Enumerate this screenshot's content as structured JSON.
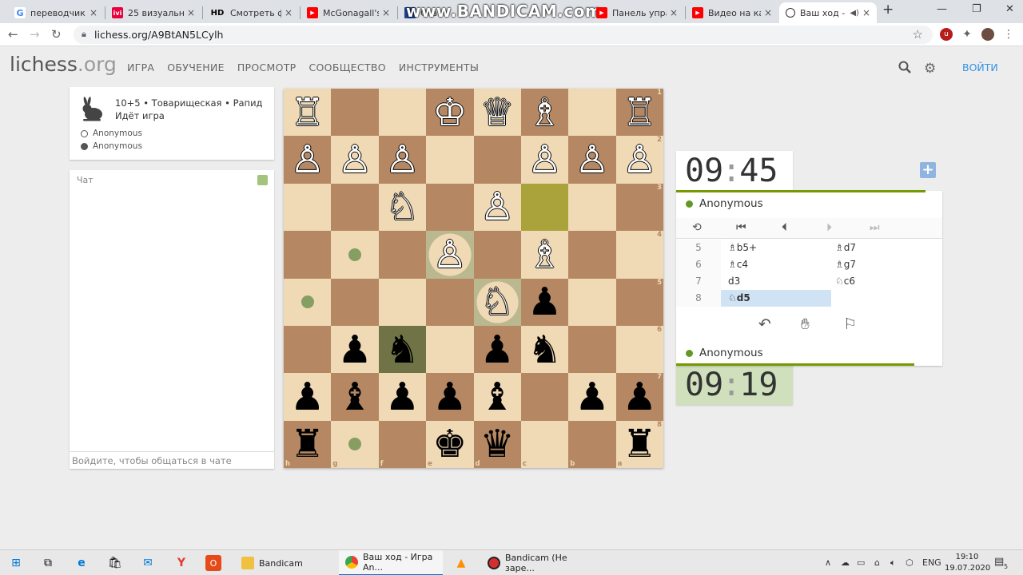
{
  "browser": {
    "tabs": [
      {
        "title": "переводчик - ",
        "icon": "google-icon",
        "color": "#ffffff"
      },
      {
        "title": "25 визуально",
        "icon": "ivi-icon",
        "color": "#ea003d"
      },
      {
        "title": "Смотреть фил",
        "icon": "hd-icon",
        "color": "#dee1e6"
      },
      {
        "title": "McGonagall's F",
        "icon": "youtube-icon",
        "color": "#ff0000"
      },
      {
        "title": "Ска",
        "icon": "uk-flag-icon",
        "color": "#1f3f8f"
      },
      {
        "title": "Панель управ",
        "icon": "youtube-icon",
        "color": "#ff0000"
      },
      {
        "title": "Видео на кана",
        "icon": "youtube-icon",
        "color": "#ff0000"
      },
      {
        "title": "Ваш ход -",
        "icon": "lichess-icon",
        "color": "#ffffff"
      }
    ],
    "hd_label": "HD",
    "watermark": "www.BANDICAM.com",
    "url": "lichess.org/A9BtAN5LCylh"
  },
  "site": {
    "logo_main": "lichess",
    "logo_tld": ".org",
    "nav": [
      "ИГРА",
      "ОБУЧЕНИЕ",
      "ПРОСМОТР",
      "СООБЩЕСТВО",
      "ИНСТРУМЕНТЫ"
    ],
    "signin": "ВОЙТИ"
  },
  "game": {
    "setup": "10+5 • Товарищеская • Рапид",
    "status": "Идёт игра",
    "player_white": "Anonymous",
    "player_black": "Anonymous"
  },
  "chat": {
    "title": "Чат",
    "placeholder": "Войдите, чтобы общаться в чате"
  },
  "clocks": {
    "top": {
      "min": "09",
      "sec": "45"
    },
    "bottom": {
      "min": "09",
      "sec": "19"
    }
  },
  "panel": {
    "top_player": "Anonymous",
    "bottom_player": "Anonymous",
    "moves": [
      {
        "num": "5",
        "white": "♗b5+",
        "black": "♗d7"
      },
      {
        "num": "6",
        "white": "♗c4",
        "black": "♗g7"
      },
      {
        "num": "7",
        "white": "d3",
        "black": "♘c6"
      },
      {
        "num": "8",
        "white": "♘d5",
        "black": ""
      }
    ]
  },
  "board": {
    "orientation": "black",
    "files_shown": [
      "h",
      "g",
      "f",
      "e",
      "d",
      "c",
      "b",
      "a"
    ],
    "ranks_shown": [
      "1",
      "2",
      "3",
      "4",
      "5",
      "6",
      "7",
      "8"
    ],
    "rows": [
      [
        "♖",
        "",
        "",
        "♔",
        "♕",
        "♗",
        "",
        "♖"
      ],
      [
        "♙",
        "♙",
        "♙",
        "",
        "",
        "♙",
        "♙",
        "♙"
      ],
      [
        "",
        "",
        "♘",
        "",
        "♙",
        "",
        "",
        ""
      ],
      [
        "",
        "",
        "",
        "♙",
        "",
        "♗",
        "",
        ""
      ],
      [
        "",
        "",
        "",
        "",
        "♘",
        "♟",
        "",
        ""
      ],
      [
        "",
        "♟",
        "♞",
        "",
        "♟",
        "♞",
        "",
        ""
      ],
      [
        "♟",
        "♝",
        "♟",
        "♟",
        "♝",
        "",
        "♟",
        "♟"
      ],
      [
        "♜",
        "",
        "",
        "♚",
        "♛",
        "",
        "",
        "♜"
      ]
    ],
    "colors": {
      "light": "#f0d9b5",
      "dark": "#b58863",
      "last_move": "#aaa23a",
      "selected": "#6f7345",
      "move_dot": "#6b8e4e"
    }
  },
  "taskbar": {
    "items": [
      {
        "label": "Bandicam",
        "color": "#f0c040"
      },
      {
        "label": "Ваш ход - Игра An...",
        "color": "#4285f4"
      },
      {
        "label": "Bandicam (Не заре...",
        "color": "#d32f2f"
      }
    ],
    "lang": "ENG",
    "time": "19:10",
    "date": "19.07.2020",
    "notif_count": "5"
  }
}
